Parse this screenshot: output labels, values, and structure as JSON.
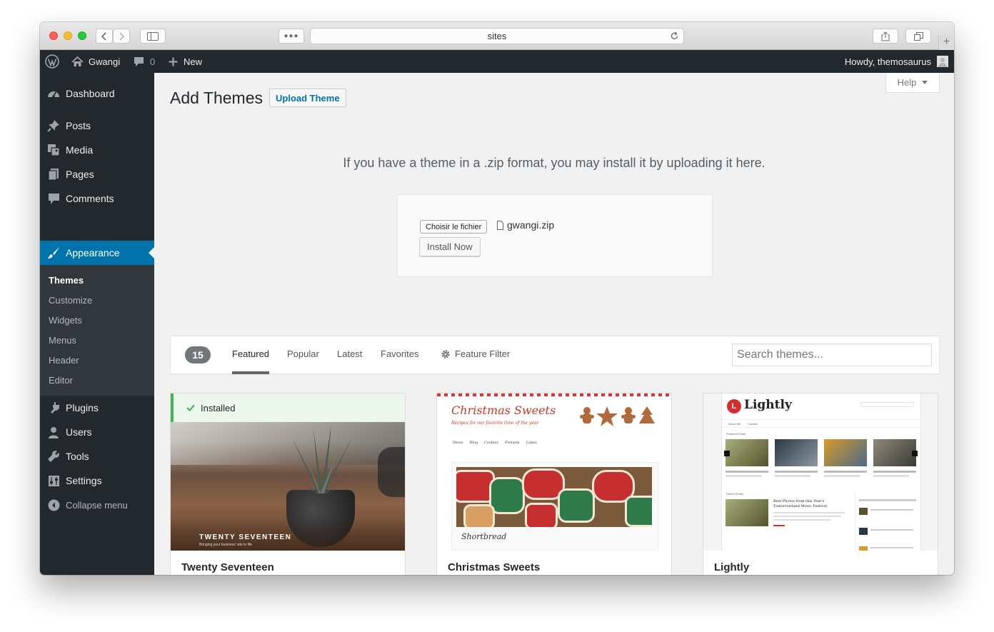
{
  "browser": {
    "url": "sites"
  },
  "adminbar": {
    "site_name": "Gwangi",
    "comments_count": "0",
    "new_label": "New",
    "howdy": "Howdy, themosaurus"
  },
  "sidebar": {
    "items": [
      {
        "label": "Dashboard",
        "icon": "dashboard-icon"
      },
      {
        "label": "Posts",
        "icon": "pin-icon"
      },
      {
        "label": "Media",
        "icon": "media-icon"
      },
      {
        "label": "Pages",
        "icon": "pages-icon"
      },
      {
        "label": "Comments",
        "icon": "comment-icon"
      },
      {
        "label": "Appearance",
        "icon": "brush-icon"
      },
      {
        "label": "Plugins",
        "icon": "plugin-icon"
      },
      {
        "label": "Users",
        "icon": "user-icon"
      },
      {
        "label": "Tools",
        "icon": "wrench-icon"
      },
      {
        "label": "Settings",
        "icon": "settings-icon"
      },
      {
        "label": "Collapse menu",
        "icon": "collapse-icon"
      }
    ],
    "appearance_submenu": [
      "Themes",
      "Customize",
      "Widgets",
      "Menus",
      "Header",
      "Editor"
    ]
  },
  "main": {
    "help_label": "Help",
    "title": "Add Themes",
    "upload_button": "Upload Theme",
    "upload_help": "If you have a theme in a .zip format, you may install it by uploading it here.",
    "file_button": "Choisir le fichier",
    "file_name": "gwangi.zip",
    "install_button": "Install Now",
    "theme_count": "15",
    "tabs": [
      "Featured",
      "Popular",
      "Latest",
      "Favorites"
    ],
    "feature_filter": "Feature Filter",
    "search_placeholder": "Search themes..."
  },
  "themes": [
    {
      "name": "Twenty Seventeen",
      "installed_label": "Installed",
      "screenshot_title": "TWENTY SEVENTEEN",
      "screenshot_tagline": "Bringing your business' site to life"
    },
    {
      "name": "Christmas Sweets",
      "screenshot_title": "Christmas Sweets",
      "screenshot_tagline": "Recipes for our favorite time of the year",
      "screenshot_nav": [
        "Menu",
        "Blog",
        "Cookies",
        "Pretzels",
        "Cakes"
      ],
      "screenshot_caption": "Shortbread"
    },
    {
      "name": "Lightly",
      "screenshot_title": "Lightly",
      "screenshot_logo_letter": "L",
      "screenshot_nav": [
        "About Me",
        "Contact"
      ],
      "screenshot_featured": "Featured Posts",
      "screenshot_recent": "Recent Posts",
      "screenshot_post_title": "Best Photos from this Year's Tomorrowland Music Festival"
    }
  ],
  "colors": {
    "admin_dark": "#23282d",
    "accent_blue": "#0073aa",
    "installed_green": "#46b450"
  }
}
